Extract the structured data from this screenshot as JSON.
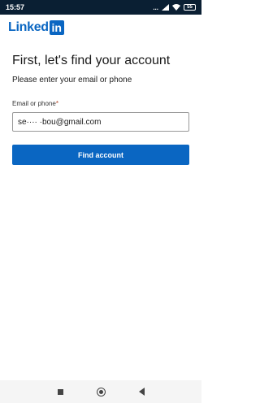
{
  "status_bar": {
    "time": "15:57",
    "indicators": "...",
    "battery": "55"
  },
  "logo": {
    "text": "Linked",
    "box": "in",
    "brand_color": "#0a66c2"
  },
  "page": {
    "title": "First, let's find your account",
    "subtitle": "Please enter your email or phone"
  },
  "form": {
    "email_label": "Email or phone",
    "required_mark": "*",
    "email_value": "se···· ·bou@gmail.com",
    "submit_label": "Find account"
  },
  "nav": {
    "icons": [
      "square-recents-icon",
      "circle-home-icon",
      "triangle-back-icon"
    ]
  }
}
